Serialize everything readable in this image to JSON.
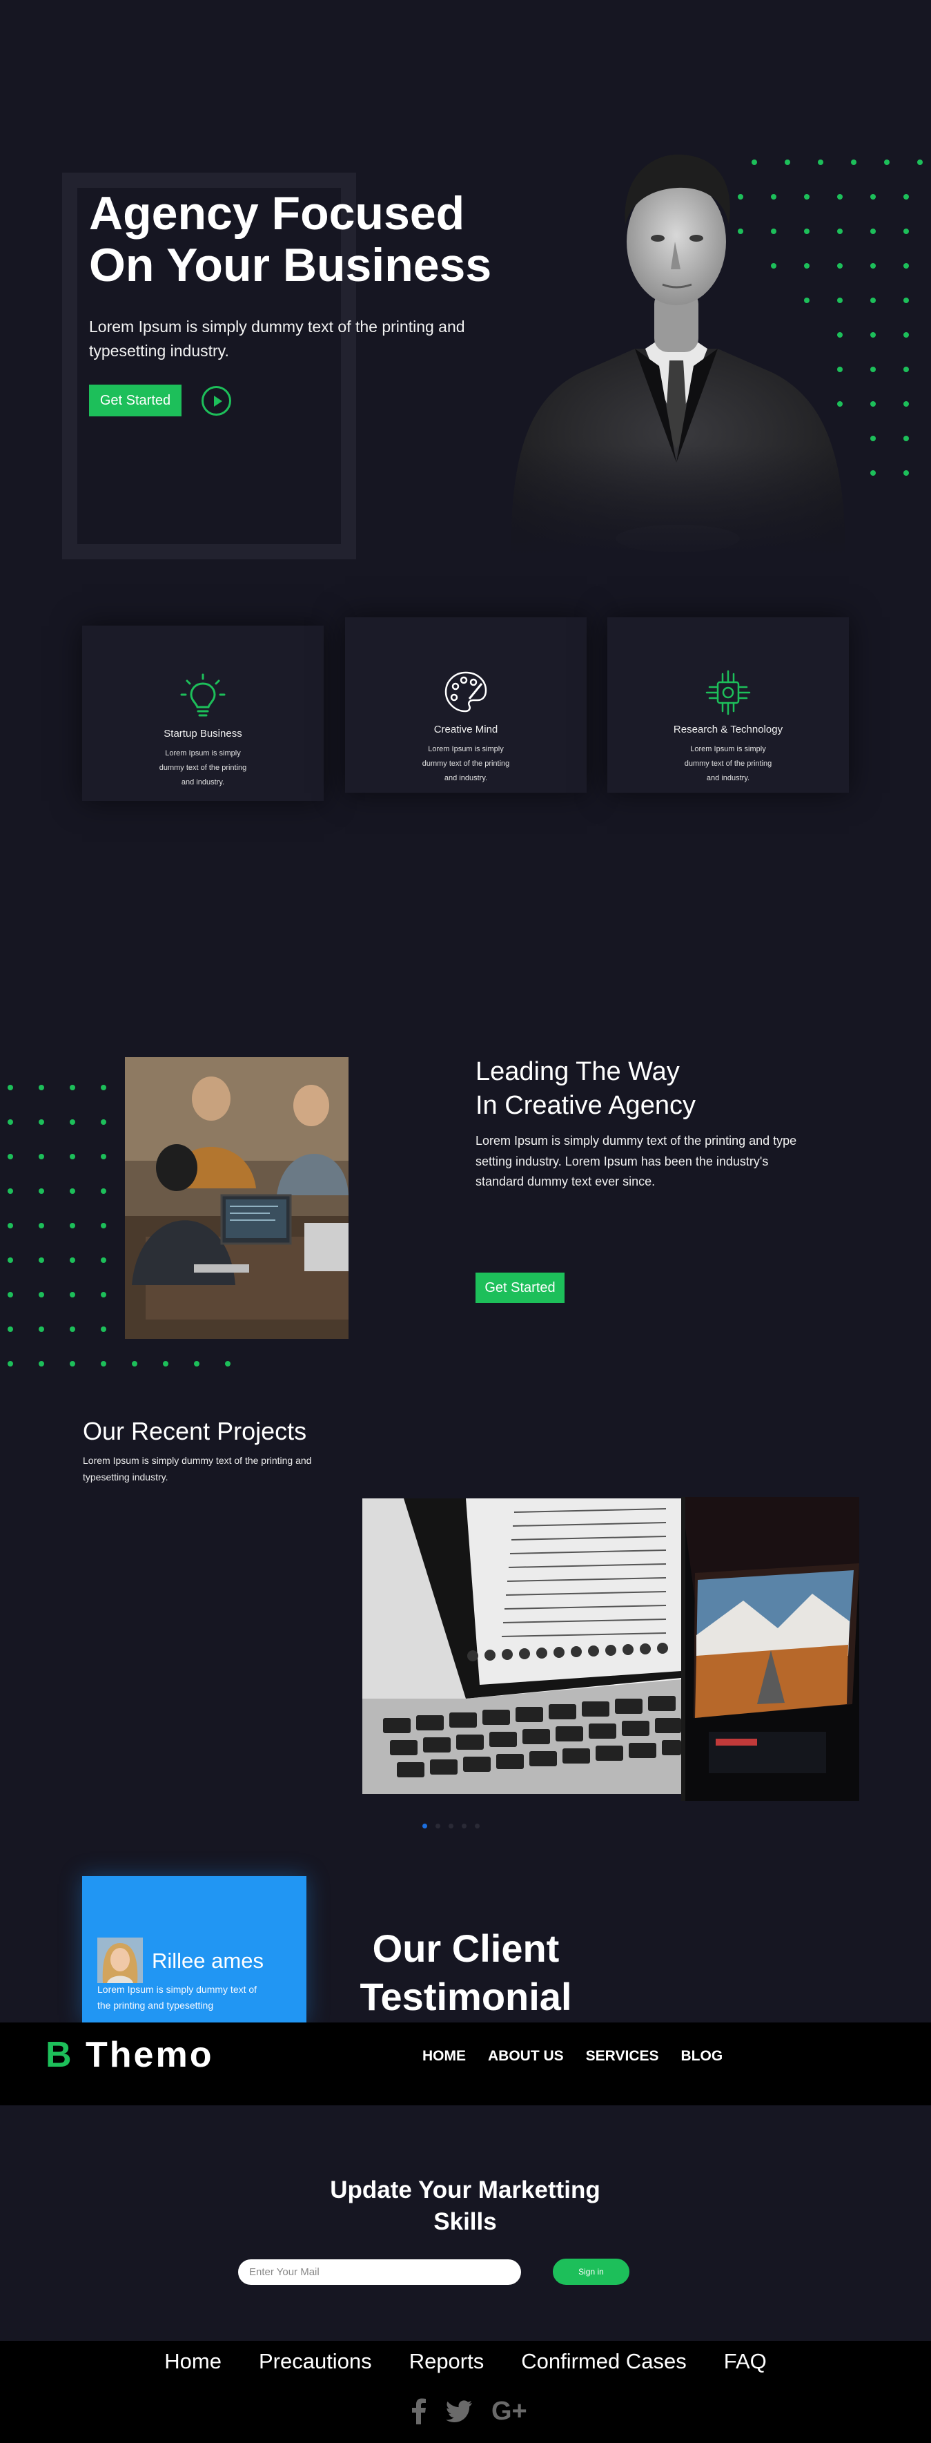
{
  "hero": {
    "title_line1": "Agency Focused",
    "title_line2": "On Your Business",
    "text": "Lorem Ipsum is simply dummy text of the printing and typesetting industry.",
    "cta": "Get Started"
  },
  "features": [
    {
      "icon": "lightbulb-icon",
      "title": "Startup Business",
      "text": "Lorem Ipsum is simply dummy text of the printing and industry."
    },
    {
      "icon": "palette-icon",
      "title": "Creative Mind",
      "text": "Lorem Ipsum is simply dummy text of the printing and industry."
    },
    {
      "icon": "chip-icon",
      "title": "Research & Technology",
      "text": "Lorem Ipsum is simply dummy text of the printing and industry."
    }
  ],
  "leading": {
    "title_line1": "Leading The Way",
    "title_line2": "In Creative Agency",
    "text": "Lorem Ipsum is simply dummy text of the printing and type setting industry. Lorem Ipsum has been the industry's standard dummy text ever since.",
    "cta": "Get Started"
  },
  "projects": {
    "title": "Our Recent Projects",
    "text": "Lorem Ipsum is simply dummy text of the printing and typesetting industry.",
    "slide_count": 5,
    "active_slide": 0
  },
  "testimonial": {
    "name": "Rillee ames",
    "text": "Lorem Ipsum is simply dummy text of the printing and typesetting",
    "heading_line1": "Our Client",
    "heading_line2": "Testimonial"
  },
  "navbar": {
    "logo_letter": "B",
    "logo_word": "Themo",
    "links": [
      "HOME",
      "ABOUT US",
      "SERVICES",
      "BLOG"
    ]
  },
  "newsletter": {
    "title_line1": "Update Your Marketting",
    "title_line2": "Skills",
    "placeholder": "Enter Your Mail",
    "button": "Sign in"
  },
  "footer": {
    "links": [
      "Home",
      "Precautions",
      "Reports",
      "Confirmed Cases",
      "FAQ"
    ],
    "social": [
      "facebook-icon",
      "twitter-icon",
      "google-plus-icon"
    ]
  },
  "colors": {
    "background": "#161622",
    "accent": "#1dbf5a",
    "testimonial_card": "#2196f3",
    "navbar": "#000000"
  }
}
